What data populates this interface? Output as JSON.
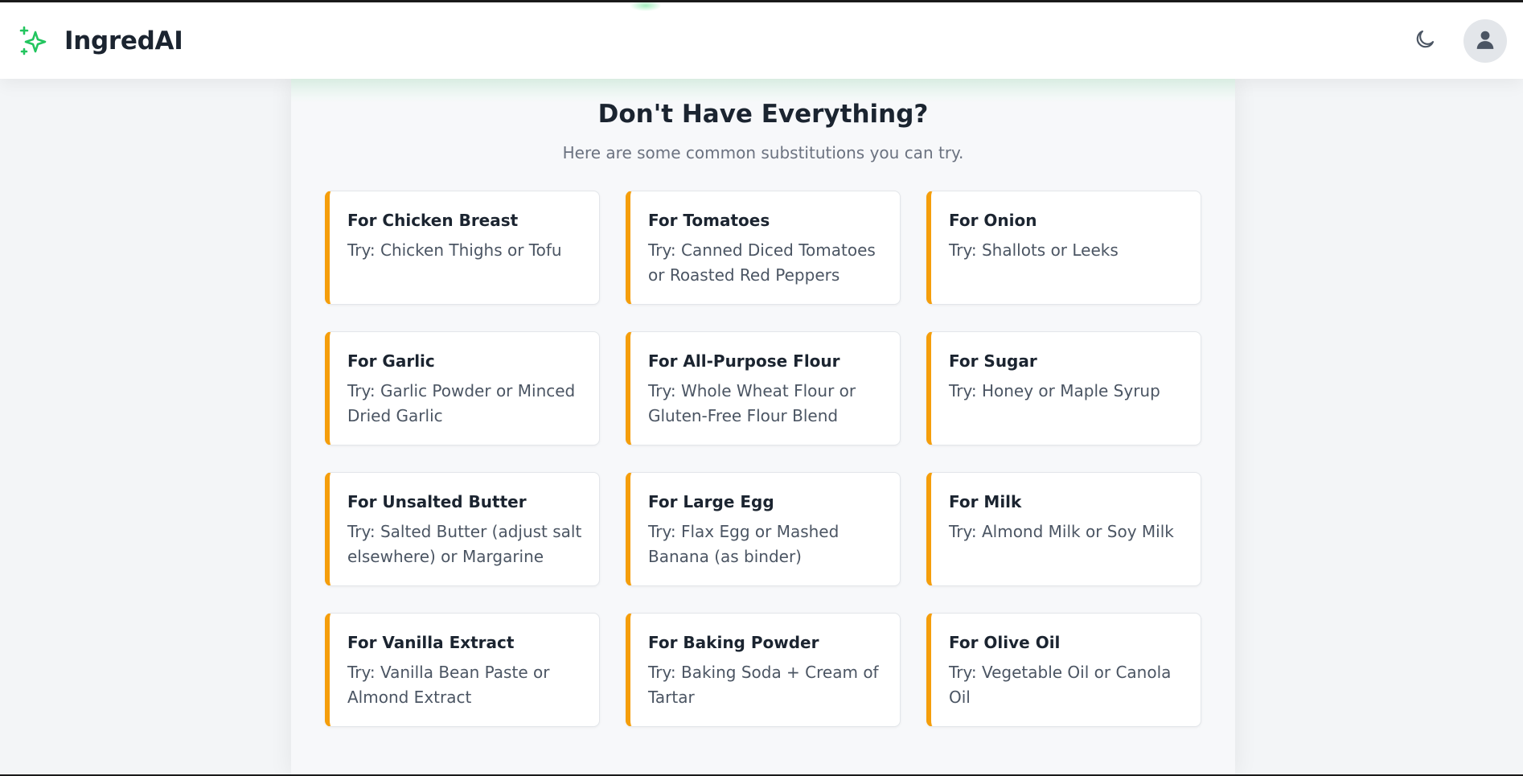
{
  "app": {
    "name": "IngredAI",
    "accent": "#22c55e"
  },
  "header": {
    "logo_icon": "sparkles-icon",
    "theme_toggle_icon": "moon-icon",
    "avatar_icon": "user-icon"
  },
  "section": {
    "title": "Don't Have Everything?",
    "subtitle": "Here are some common substitutions you can try."
  },
  "colors": {
    "card_accent": "#f59e0b",
    "background": "#f3f5f7"
  },
  "substitutions": [
    {
      "title": "For Chicken Breast",
      "text": "Try: Chicken Thighs or Tofu"
    },
    {
      "title": "For Tomatoes",
      "text": "Try: Canned Diced Tomatoes or Roasted Red Peppers"
    },
    {
      "title": "For Onion",
      "text": "Try: Shallots or Leeks"
    },
    {
      "title": "For Garlic",
      "text": "Try: Garlic Powder or Minced Dried Garlic"
    },
    {
      "title": "For All-Purpose Flour",
      "text": "Try: Whole Wheat Flour or Gluten-Free Flour Blend"
    },
    {
      "title": "For Sugar",
      "text": "Try: Honey or Maple Syrup"
    },
    {
      "title": "For Unsalted Butter",
      "text": "Try: Salted Butter (adjust salt elsewhere) or Margarine"
    },
    {
      "title": "For Large Egg",
      "text": "Try: Flax Egg or Mashed Banana (as binder)"
    },
    {
      "title": "For Milk",
      "text": "Try: Almond Milk or Soy Milk"
    },
    {
      "title": "For Vanilla Extract",
      "text": "Try: Vanilla Bean Paste or Almond Extract"
    },
    {
      "title": "For Baking Powder",
      "text": "Try: Baking Soda + Cream of Tartar"
    },
    {
      "title": "For Olive Oil",
      "text": "Try: Vegetable Oil or Canola Oil"
    }
  ]
}
